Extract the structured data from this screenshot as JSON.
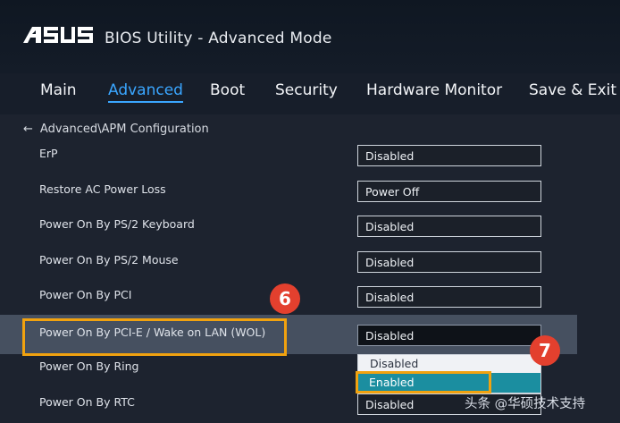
{
  "header": {
    "logo_text": "ASUS",
    "title": "BIOS Utility - Advanced Mode"
  },
  "tabs": [
    {
      "label": "Main",
      "active": false
    },
    {
      "label": "Advanced",
      "active": true
    },
    {
      "label": "Boot",
      "active": false
    },
    {
      "label": "Security",
      "active": false
    },
    {
      "label": "Hardware Monitor",
      "active": false
    },
    {
      "label": "Save & Exit",
      "active": false
    }
  ],
  "breadcrumb": {
    "arrow": "←",
    "path": "Advanced\\APM Configuration"
  },
  "settings": [
    {
      "label": "ErP",
      "value": "Disabled"
    },
    {
      "label": "Restore AC Power Loss",
      "value": "Power Off"
    },
    {
      "label": "Power On By PS/2 Keyboard",
      "value": "Disabled"
    },
    {
      "label": "Power On By PS/2 Mouse",
      "value": "Disabled"
    },
    {
      "label": "Power On By PCI",
      "value": "Disabled"
    },
    {
      "label": "Power On By PCI-E / Wake on LAN (WOL)",
      "value": "Disabled"
    },
    {
      "label": "Power On By Ring",
      "value": ""
    },
    {
      "label": "Power On By RTC",
      "value": "Disabled"
    }
  ],
  "dropdown": {
    "options": [
      "Disabled",
      "Enabled"
    ],
    "selected": "Enabled"
  },
  "annotations": {
    "step6": "6",
    "step7": "7",
    "highlight_color": "#f1a20f",
    "badge_color": "#e3402e"
  },
  "watermark": "头条 @华硕技术支持",
  "colors": {
    "accent": "#3aa6ff",
    "background": "#1d232f",
    "selected_row": "#465060",
    "dropdown_highlight": "#1b8ea0"
  }
}
